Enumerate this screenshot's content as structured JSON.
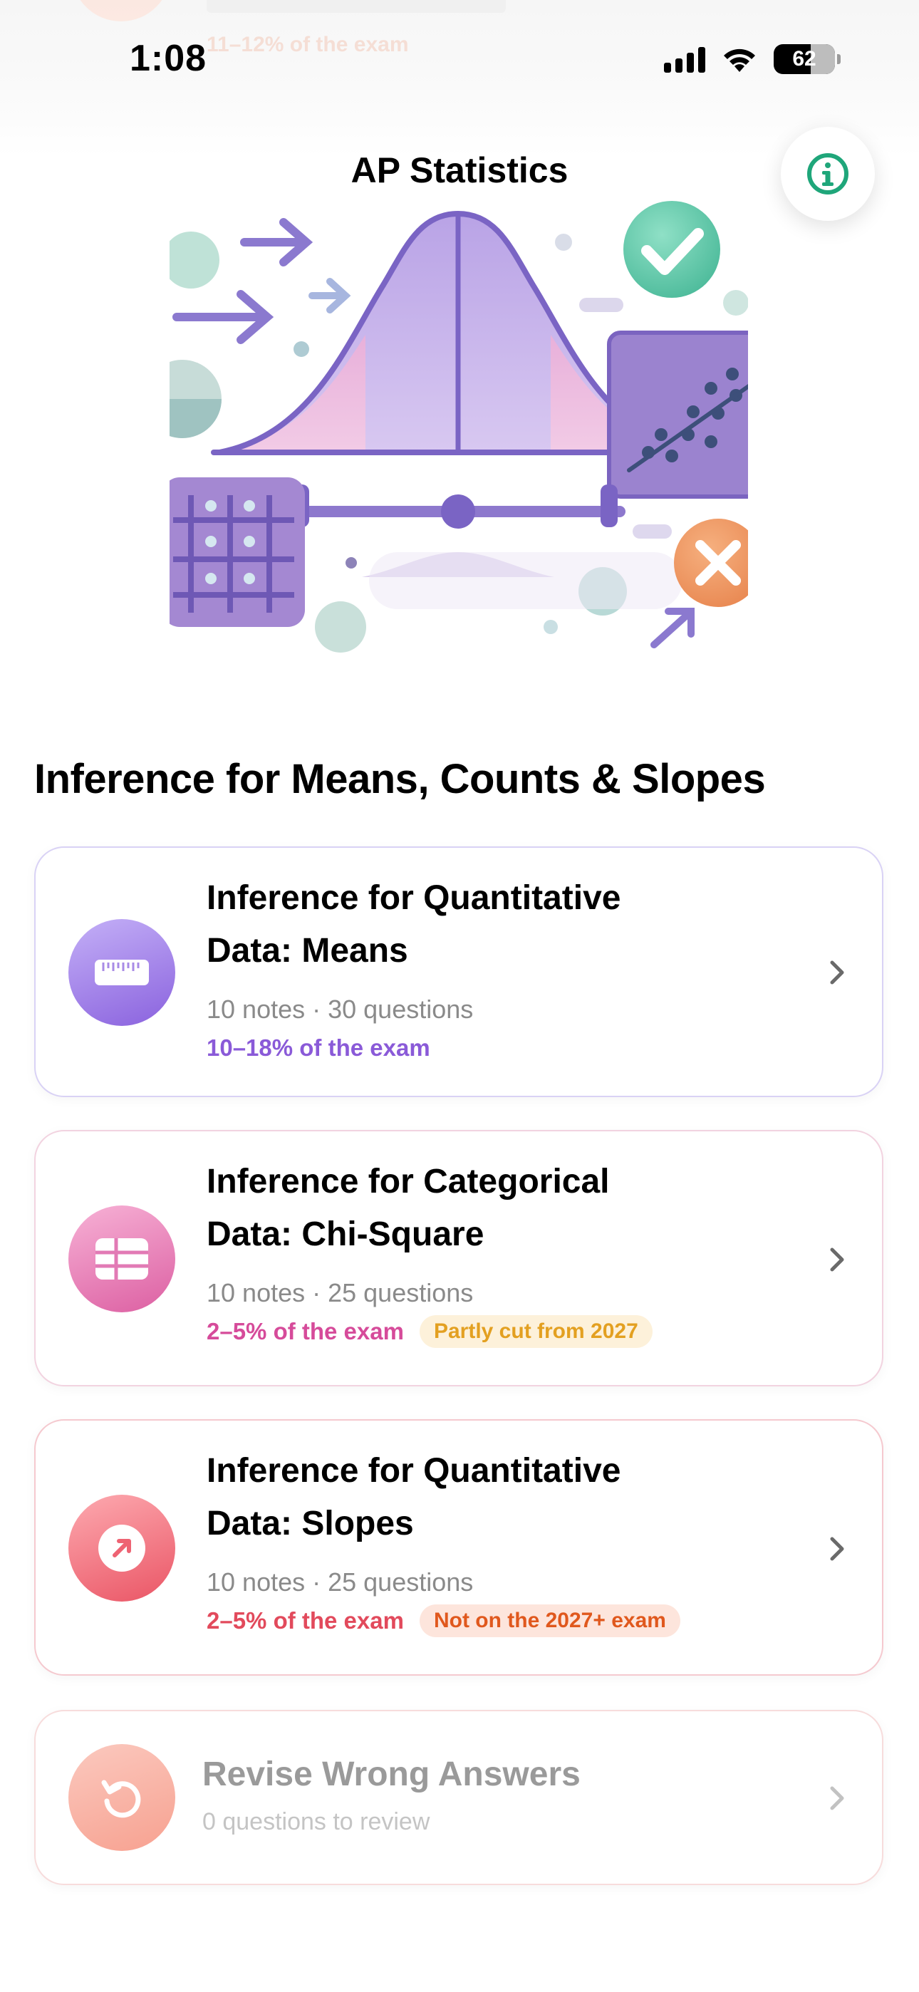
{
  "status_bar": {
    "time": "1:08",
    "battery": "62"
  },
  "background_ghost": {
    "text": "11–12% of the exam"
  },
  "header": {
    "title": "AP Statistics"
  },
  "section": {
    "title": "Inference for Means, Counts & Slopes"
  },
  "cards": [
    {
      "title_line1": "Inference for Quantitative",
      "title_line2": "Data: Means",
      "meta": "10 notes · 30 questions",
      "exam_pct": "10–18% of the exam",
      "pct_color": "#8a5ad8",
      "icon": "ruler-icon"
    },
    {
      "title_line1": "Inference for Categorical",
      "title_line2": "Data: Chi-Square",
      "meta": "10 notes · 25 questions",
      "exam_pct": "2–5% of the exam",
      "pct_color": "#d64b9a",
      "badge": "Partly cut from 2027",
      "icon": "table-icon"
    },
    {
      "title_line1": "Inference for Quantitative",
      "title_line2": "Data: Slopes",
      "meta": "10 notes · 25 questions",
      "exam_pct": "2–5% of the exam",
      "pct_color": "#e24a5c",
      "badge": "Not on the 2027+ exam",
      "icon": "trend-arrow-icon"
    },
    {
      "title": "Revise Wrong Answers",
      "meta": "0 questions to review",
      "icon": "redo-icon"
    }
  ],
  "colors": {
    "accent_green": "#1fa67a",
    "means_gradient": [
      "#c0a9f5",
      "#8d68e0"
    ],
    "chisq_gradient": [
      "#f5a6cf",
      "#de62a5"
    ],
    "slopes_gradient": [
      "#fca3a8",
      "#ec5a67"
    ],
    "revise_gradient": [
      "#fbc4b8",
      "#f8a596"
    ]
  }
}
